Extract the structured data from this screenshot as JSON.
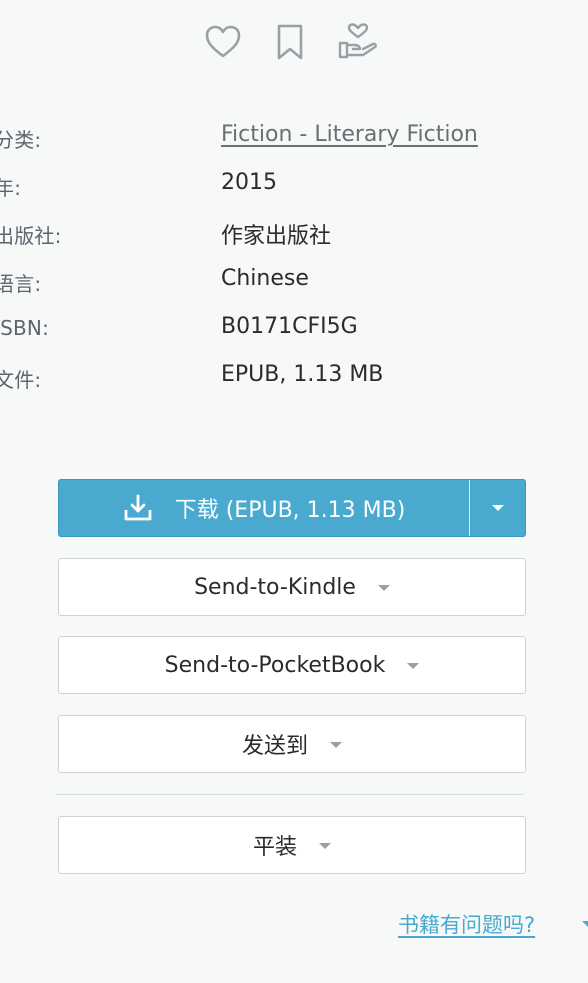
{
  "actions": {
    "favorite_icon": "heart-icon",
    "bookmark_icon": "bookmark-icon",
    "donate_icon": "hand-heart-icon"
  },
  "details": {
    "category": {
      "label": "分类:",
      "value": "Fiction - Literary Fiction"
    },
    "year": {
      "label": "年:",
      "value": "2015"
    },
    "publisher": {
      "label": "出版社:",
      "value": "作家出版社"
    },
    "language": {
      "label": "语言:",
      "value": "Chinese"
    },
    "isbn": {
      "label": "ISBN:",
      "value": "B0171CFI5G"
    },
    "file": {
      "label": "文件:",
      "value": "EPUB, 1.13 MB"
    }
  },
  "buttons": {
    "download": "下载 (EPUB, 1.13 MB)",
    "send_to_kindle": "Send-to-Kindle",
    "send_to_pocketbook": "Send-to-PocketBook",
    "send_to": "发送到",
    "paperback": "平装"
  },
  "links": {
    "report_problem": "书籍有问题吗?"
  },
  "colors": {
    "accent": "#49a9cf",
    "text": "#2b2b2b",
    "muted": "#5f6470",
    "border": "#cfd3d6"
  }
}
